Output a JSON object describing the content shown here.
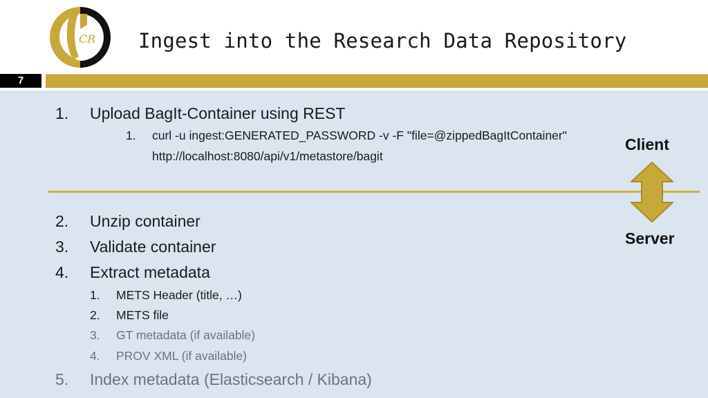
{
  "header": {
    "title": "Ingest into the Research Data Repository",
    "logo_text": "CR",
    "slide_number": "7"
  },
  "colors": {
    "gold": "#c7a83a",
    "content_background": "#dbe5f0",
    "muted_text": "#6d7278"
  },
  "steps": [
    {
      "num": "1.",
      "text": "Upload BagIt-Container using REST",
      "sub": [
        {
          "num": "1.",
          "text": "curl -u ingest:GENERATED_PASSWORD -v -F \"file=@zippedBagItContainer\"",
          "continuation": "http://localhost:8080/api/v1/metastore/bagit"
        }
      ]
    },
    {
      "num": "2.",
      "text": "Unzip container"
    },
    {
      "num": "3.",
      "text": "Validate container"
    },
    {
      "num": "4.",
      "text": "Extract metadata",
      "sub": [
        {
          "num": "1.",
          "text": "METS Header (title, …)"
        },
        {
          "num": "2.",
          "text": "METS file"
        },
        {
          "num": "3.",
          "text": "GT metadata (if available)",
          "muted": true
        },
        {
          "num": "4.",
          "text": "PROV XML (if available)",
          "muted": true
        }
      ]
    },
    {
      "num": "5.",
      "text": "Index metadata (Elasticsearch / Kibana)",
      "muted": true
    }
  ],
  "diagram": {
    "top_label": "Client",
    "bottom_label": "Server",
    "arrow_icon": "double-headed-vertical-arrow"
  }
}
